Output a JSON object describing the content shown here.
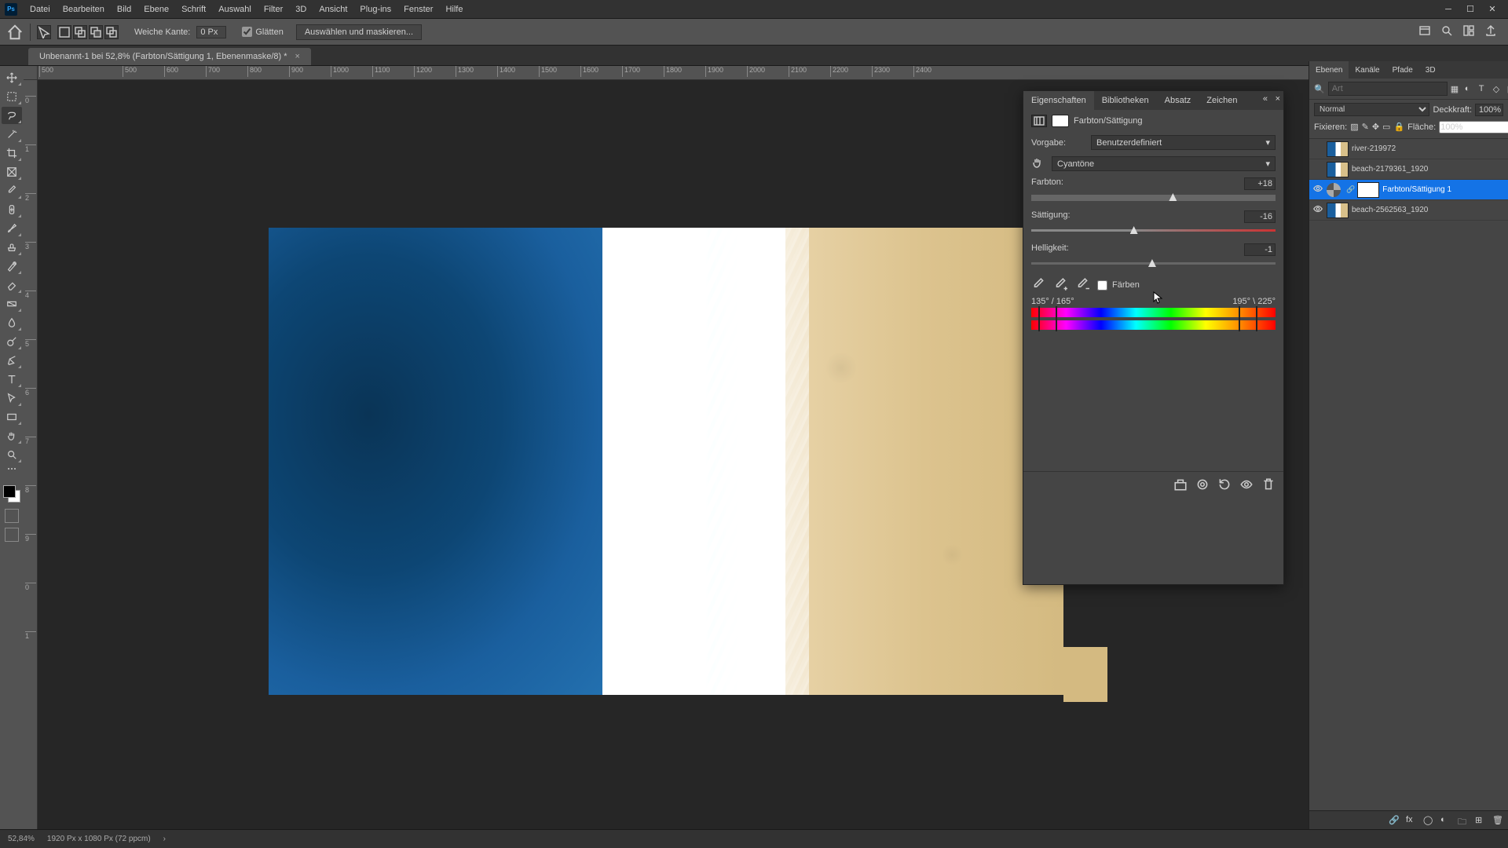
{
  "menu": [
    "Datei",
    "Bearbeiten",
    "Bild",
    "Ebene",
    "Schrift",
    "Auswahl",
    "Filter",
    "3D",
    "Ansicht",
    "Plug-ins",
    "Fenster",
    "Hilfe"
  ],
  "options": {
    "feather_label": "Weiche Kante:",
    "feather_value": "0 Px",
    "antialias": "Glätten",
    "select_mask": "Auswählen und maskieren..."
  },
  "doc_tab": "Unbenannt-1 bei 52,8% (Farbton/Sättigung 1, Ebenenmaske/8) *",
  "ruler_ticks_h": [
    "500",
    "600",
    "700",
    "800",
    "900",
    "1000",
    "1100",
    "1200",
    "1300",
    "1400",
    "1500",
    "1600",
    "1700",
    "1800",
    "1900",
    "2000",
    "2100",
    "2200",
    "2300",
    "2400"
  ],
  "ruler_neg": "500",
  "ruler_ticks_v": [
    "0",
    "1",
    "2",
    "3",
    "4",
    "5",
    "6",
    "7",
    "8",
    "9",
    "0",
    "1"
  ],
  "properties": {
    "tabs": [
      "Eigenschaften",
      "Bibliotheken",
      "Absatz",
      "Zeichen"
    ],
    "title": "Farbton/Sättigung",
    "preset_label": "Vorgabe:",
    "preset_value": "Benutzerdefiniert",
    "channel_value": "Cyantöne",
    "hue_label": "Farbton:",
    "hue_value": "+18",
    "sat_label": "Sättigung:",
    "sat_value": "-16",
    "light_label": "Helligkeit:",
    "light_value": "-1",
    "colorize": "Färben",
    "range_left": "135° / 165°",
    "range_right": "195° \\ 225°"
  },
  "layers_panel": {
    "tabs": [
      "Ebenen",
      "Kanäle",
      "Pfade",
      "3D"
    ],
    "search_placeholder": "Art",
    "blend": "Normal",
    "opacity_label": "Deckkraft:",
    "opacity_value": "100%",
    "lock_label": "Fixieren:",
    "fill_label": "Fläche:",
    "fill_value": "100%",
    "layers": [
      {
        "name": "river-219972",
        "visible": false,
        "type": "image"
      },
      {
        "name": "beach-2179361_1920",
        "visible": false,
        "type": "image"
      },
      {
        "name": "Farbton/Sättigung 1",
        "visible": true,
        "type": "adjustment",
        "selected": true
      },
      {
        "name": "beach-2562563_1920",
        "visible": true,
        "type": "image"
      }
    ]
  },
  "status": {
    "zoom": "52,84%",
    "docinfo": "1920 Px x 1080 Px (72 ppcm)"
  }
}
